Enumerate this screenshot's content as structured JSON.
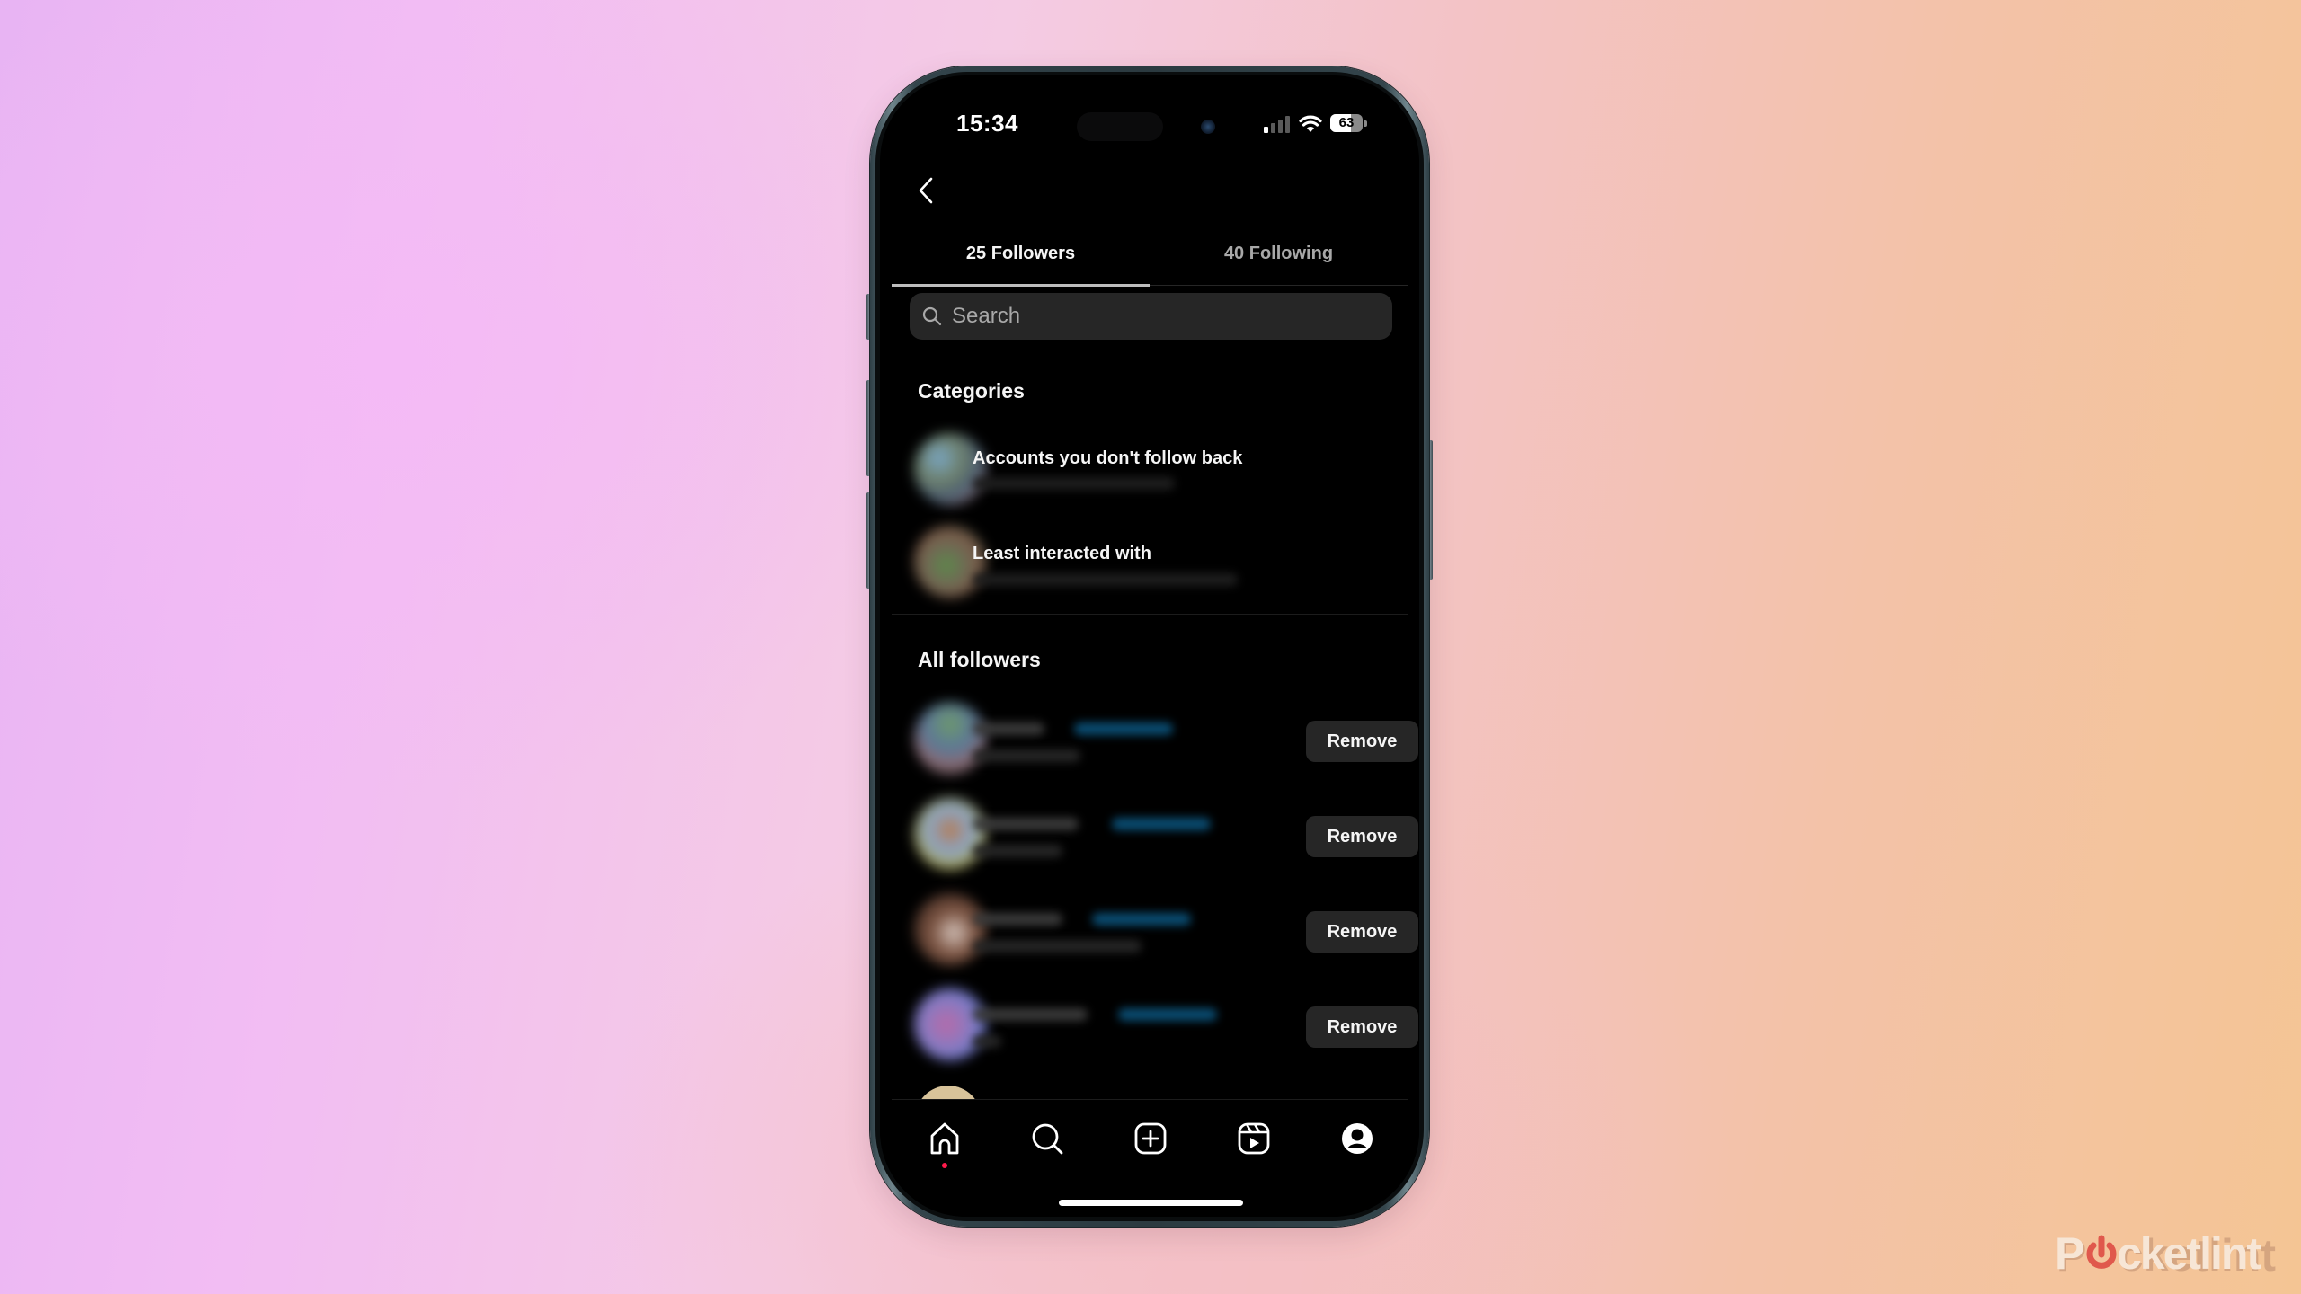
{
  "status_bar": {
    "time": "15:34",
    "battery_percent": "63",
    "signal_icon": "cellular-signal-icon",
    "wifi_icon": "wifi-icon"
  },
  "header": {
    "back_icon": "chevron-left-icon"
  },
  "tabs": [
    {
      "label": "25 Followers",
      "active": true
    },
    {
      "label": "40 Following",
      "active": false
    }
  ],
  "search": {
    "placeholder": "Search",
    "value": "",
    "icon": "search-icon"
  },
  "categories": {
    "title": "Categories",
    "items": [
      {
        "label": "Accounts you don't follow back",
        "subtitle_blurred": true
      },
      {
        "label": "Least interacted with",
        "subtitle_blurred": true
      }
    ]
  },
  "all_followers": {
    "title": "All followers",
    "rows": [
      {
        "username_blurred": true,
        "follow_back_blurred": true,
        "subtitle_blurred": true,
        "action": "Remove"
      },
      {
        "username_blurred": true,
        "follow_back_blurred": true,
        "subtitle_blurred": true,
        "action": "Remove"
      },
      {
        "username_blurred": true,
        "follow_back_blurred": true,
        "subtitle_blurred": true,
        "action": "Remove"
      },
      {
        "username_blurred": true,
        "follow_back_blurred": true,
        "subtitle_blurred": true,
        "action": "Remove"
      }
    ]
  },
  "bottom_nav": {
    "items": [
      {
        "icon": "home-icon",
        "notification_dot": true
      },
      {
        "icon": "search-icon"
      },
      {
        "icon": "create-post-icon"
      },
      {
        "icon": "reels-icon"
      },
      {
        "icon": "profile-icon"
      }
    ]
  },
  "colors": {
    "screen_bg": "#000000",
    "button_bg": "#262626",
    "primary_text": "#f5f5f5",
    "secondary_text": "#a8a8a8",
    "notification_dot": "#ff1a4b",
    "follow_back_blue": "#0a4d73"
  },
  "watermark": {
    "text_before": "P",
    "text_after": "cketlint",
    "brand": "Pocketlint"
  }
}
